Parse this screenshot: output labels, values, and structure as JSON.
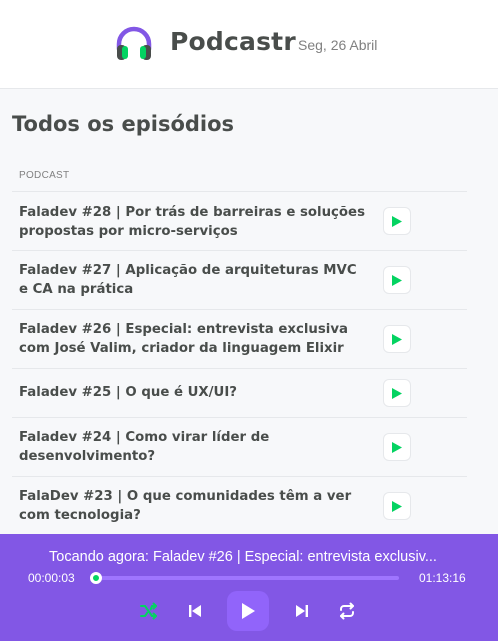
{
  "header": {
    "brand": "Podcastr",
    "date": "Seg, 26 Abril",
    "logo_icon": "headphones-icon"
  },
  "episodes_section": {
    "title": "Todos os episódios",
    "column_header": "PODCAST",
    "episodes": [
      {
        "title": "Faladev #28 | Por trás de barreiras e soluções propostas por micro-serviços"
      },
      {
        "title": "Faladev #27 | Aplicação de arquiteturas MVC e CA na prática"
      },
      {
        "title": "Faladev #26 | Especial: entrevista exclusiva com José Valim, criador da linguagem Elixir"
      },
      {
        "title": "Faladev #25 | O que é UX/UI?"
      },
      {
        "title": "Faladev #24 | Como virar líder de desenvolvimento?"
      },
      {
        "title": "FalaDev #23 | O que comunidades têm a ver com tecnologia?"
      }
    ],
    "play_icon": "play-icon"
  },
  "player": {
    "now_playing": "Tocando agora: Faladev #26 | Especial: entrevista exclusiv...",
    "current_time": "00:00:03",
    "duration": "01:13:16",
    "progress_fraction": 0.0007,
    "controls": [
      "shuffle-icon",
      "previous-icon",
      "play-icon",
      "next-icon",
      "repeat-icon"
    ]
  },
  "colors": {
    "accent": "#8257e5",
    "accent_light": "#9164fa",
    "green": "#04d361",
    "text": "#494d4b",
    "muted": "#808080"
  }
}
